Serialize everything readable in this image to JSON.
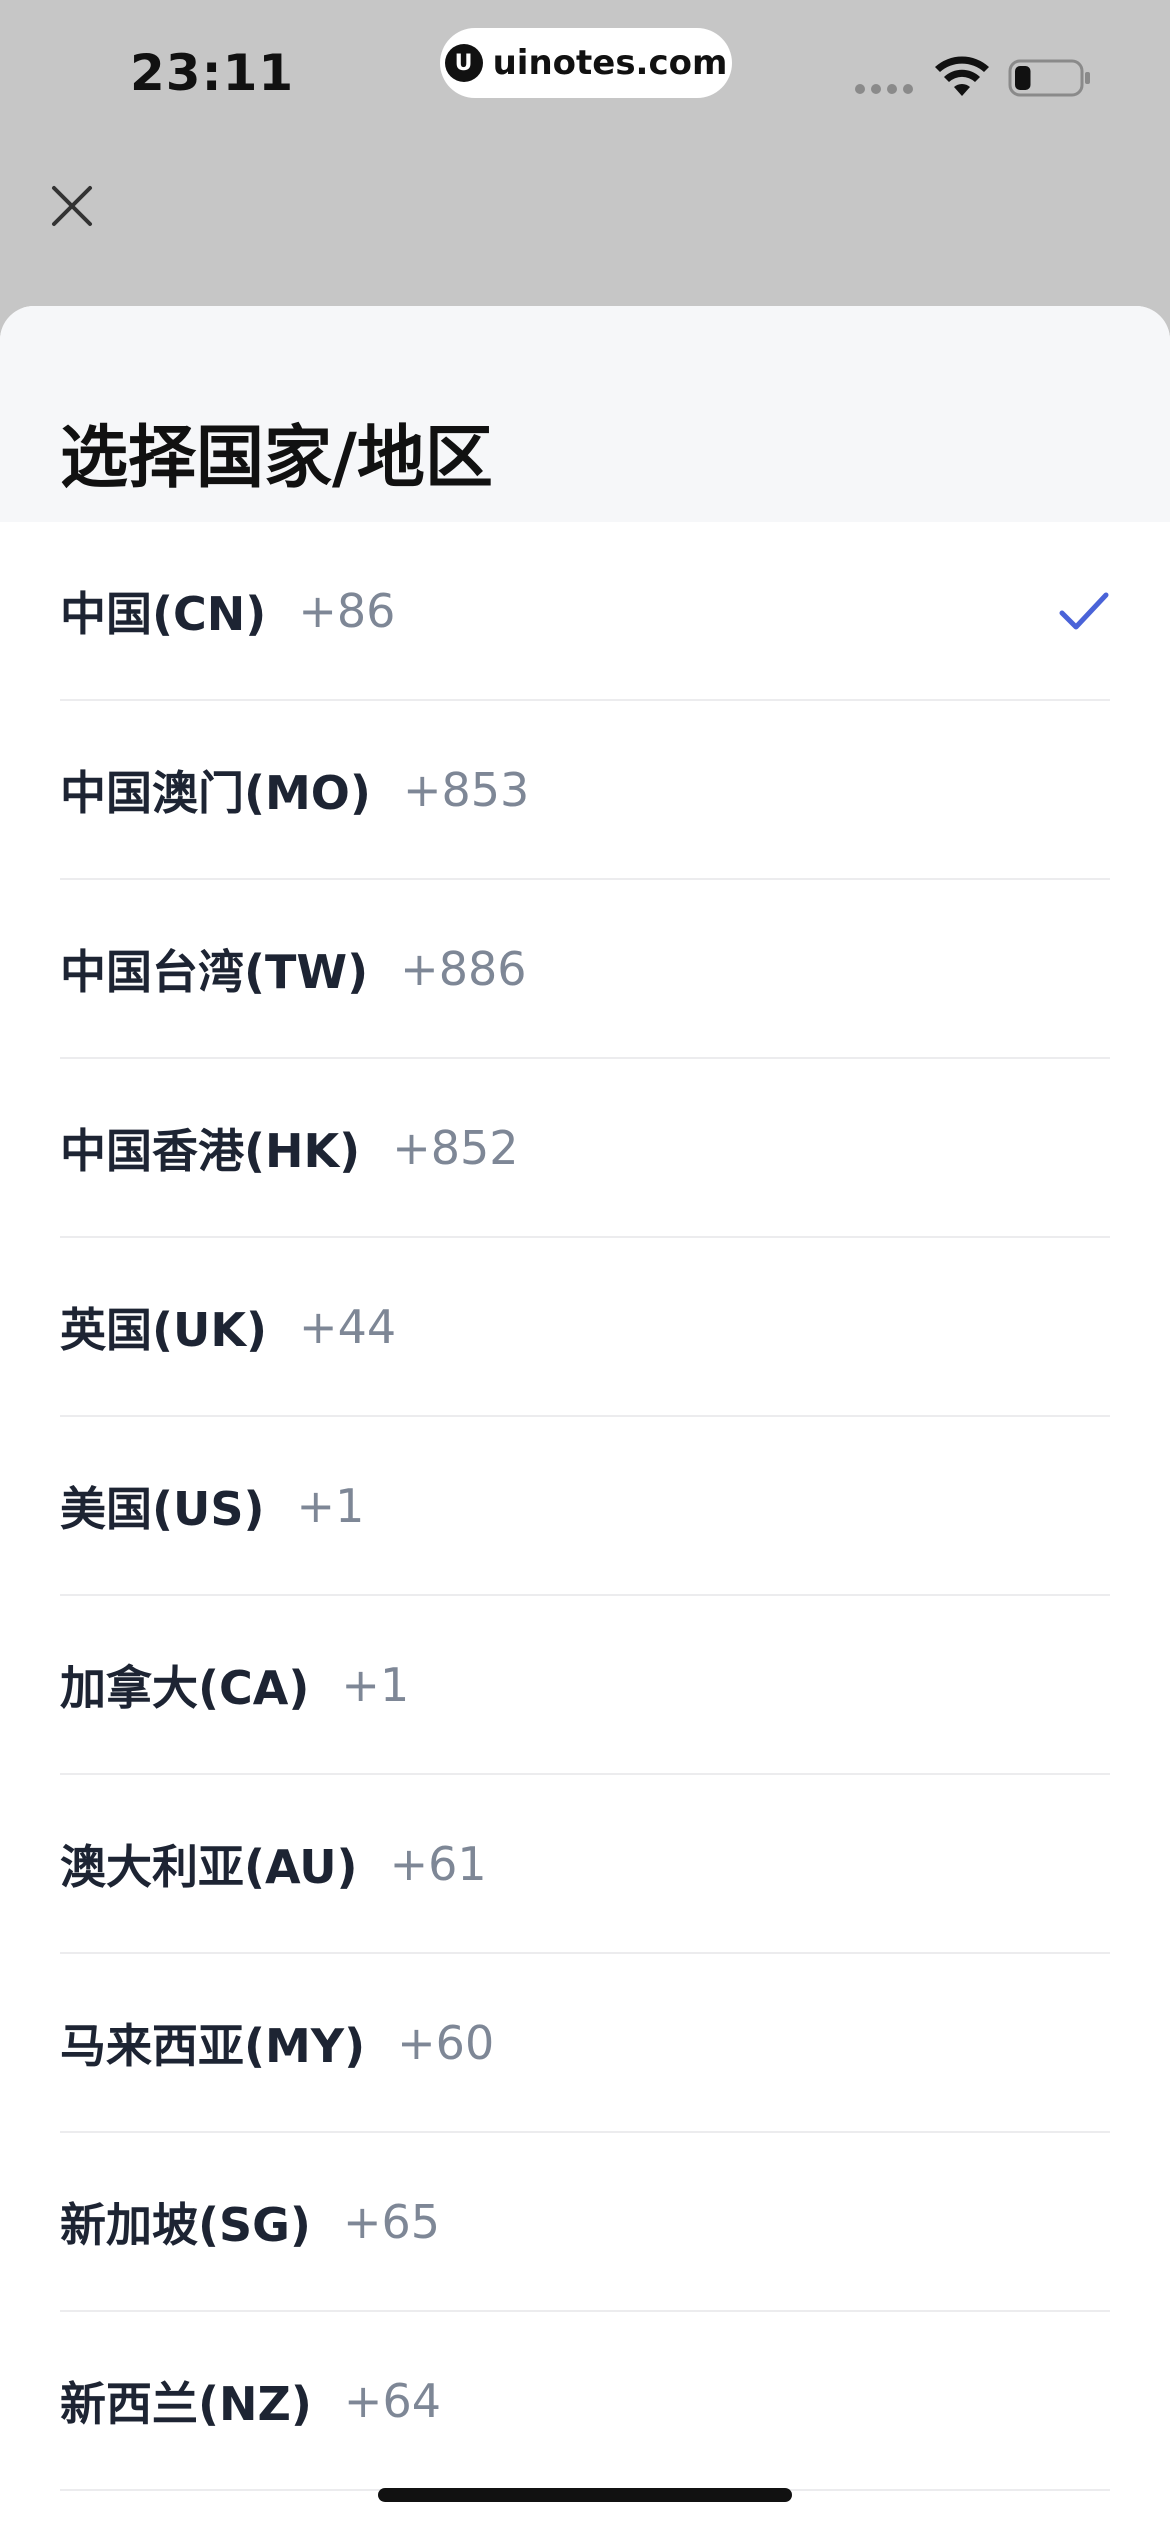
{
  "status_bar": {
    "time": "23:11",
    "url": "uinotes.com",
    "battery_level": 0.25
  },
  "header": {
    "close_icon": "close-icon"
  },
  "sheet": {
    "title": "选择国家/地区",
    "selected_index": 0,
    "accent_color": "#4a63d8",
    "countries": [
      {
        "name": "中国(CN)",
        "code": "+86"
      },
      {
        "name": "中国澳门(MO)",
        "code": "+853"
      },
      {
        "name": "中国台湾(TW)",
        "code": "+886"
      },
      {
        "name": "中国香港(HK)",
        "code": "+852"
      },
      {
        "name": "英国(UK)",
        "code": "+44"
      },
      {
        "name": "美国(US)",
        "code": "+1"
      },
      {
        "name": "加拿大(CA)",
        "code": "+1"
      },
      {
        "name": "澳大利亚(AU)",
        "code": "+61"
      },
      {
        "name": "马来西亚(MY)",
        "code": "+60"
      },
      {
        "name": "新加坡(SG)",
        "code": "+65"
      },
      {
        "name": "新西兰(NZ)",
        "code": "+64"
      }
    ]
  }
}
